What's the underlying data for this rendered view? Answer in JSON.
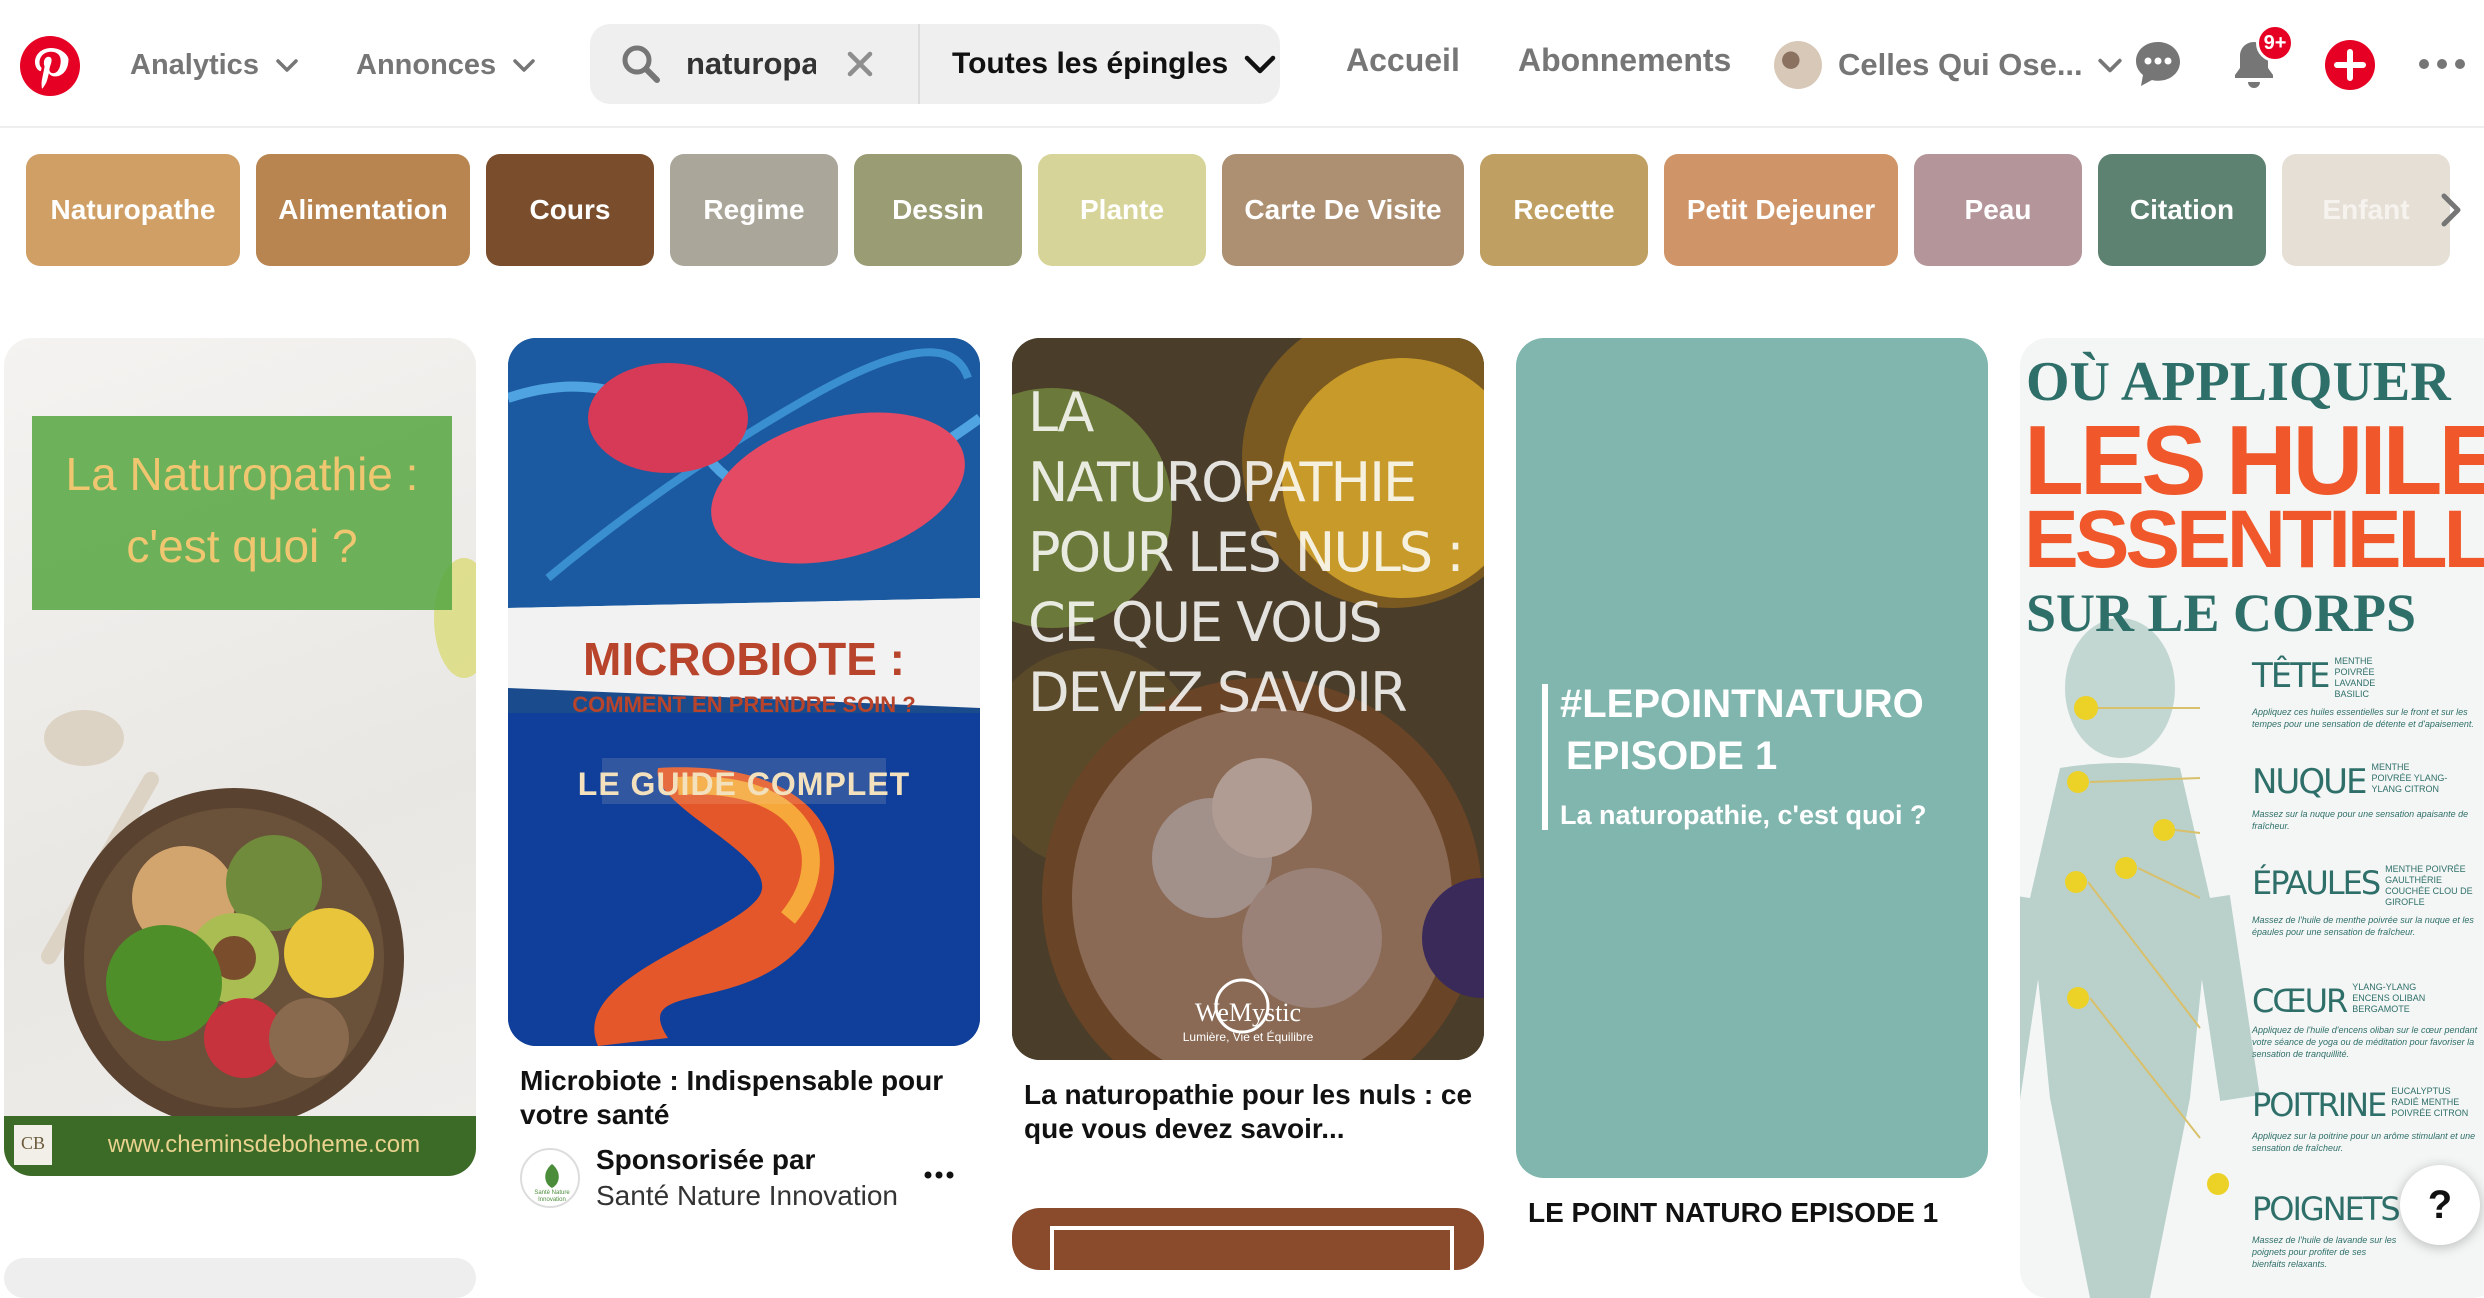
{
  "header": {
    "nav_analytics": "Analytics",
    "nav_annonces": "Annonces",
    "search_value": "naturopa",
    "search_scope": "Toutes les épingles",
    "link_accueil": "Accueil",
    "link_abonnements": "Abonnements",
    "account_name": "Celles Qui Ose...",
    "notif_badge": "9+"
  },
  "chips": [
    {
      "label": "Naturopathe",
      "color": "#cf9f66"
    },
    {
      "label": "Alimentation",
      "color": "#b8844f"
    },
    {
      "label": "Cours",
      "color": "#7a4e2c"
    },
    {
      "label": "Regime",
      "color": "#aaa69a"
    },
    {
      "label": "Dessin",
      "color": "#9a9c74"
    },
    {
      "label": "Plante",
      "color": "#d7d49a"
    },
    {
      "label": "Carte De Visite",
      "color": "#ad9072"
    },
    {
      "label": "Recette",
      "color": "#bf9f62"
    },
    {
      "label": "Petit Dejeuner",
      "color": "#cf9568"
    },
    {
      "label": "Peau",
      "color": "#b4969a"
    },
    {
      "label": "Citation",
      "color": "#5e8272"
    },
    {
      "label": "Enfant",
      "color": "#e6dfd6"
    }
  ],
  "pins": {
    "p1": {
      "heading": "La Naturopathie :\nc'est quoi ?",
      "footer_url": "www.cheminsdeboheme.com",
      "logo_text": "CB"
    },
    "p2": {
      "headline": "MICROBIOTE :",
      "subline": "COMMENT EN PRENDRE SOIN ?",
      "banner": "LE GUIDE COMPLET",
      "title": "Microbiote : Indispensable pour votre santé",
      "sponsored_label": "Sponsorisée par",
      "sponsor": "Santé Nature Innovation",
      "sponsor_logo_text": "Santé Nature Innovation"
    },
    "p3": {
      "overlay": "LA NATUROPATHIE POUR LES NULS : CE QUE VOUS DEVEZ SAVOIR",
      "brand": "WeMystic",
      "brand_tagline": "Lumière, Vie et Équilibre",
      "title": "La naturopathie pour les nuls : ce que vous devez savoir..."
    },
    "p4": {
      "hashtag_line1": "#LEPOINTNATURO",
      "hashtag_line2": "EPISODE 1",
      "sub": "La naturopathie, c'est quoi ?",
      "title": "LE POINT NATURO EPISODE 1"
    },
    "p5": {
      "line1": "OÙ APPLIQUER",
      "line2": "LES HUILES",
      "line3": "ESSENTIELLES",
      "line4": "SUR LE CORPS",
      "parts": [
        {
          "name": "TÊTE",
          "oils": "MENTHE POIVRÉE LAVANDE BASILIC",
          "desc": "Appliquez ces huiles essentielles sur le front et sur les tempes pour une sensation de détente et d'apaisement."
        },
        {
          "name": "NUQUE",
          "oils": "MENTHE POIVRÉE YLANG-YLANG CITRON",
          "desc": "Massez sur la nuque pour une sensation apaisante de fraîcheur."
        },
        {
          "name": "ÉPAULES",
          "oils": "MENTHE POIVRÉE GAULTHÉRIE COUCHÉE CLOU DE GIROFLE",
          "desc": "Massez de l'huile de menthe poivrée sur la nuque et les épaules pour une sensation de fraîcheur."
        },
        {
          "name": "CŒUR",
          "oils": "YLANG-YLANG ENCENS OLIBAN BERGAMOTE",
          "desc": "Appliquez de l'huile d'encens oliban sur le cœur pendant votre séance de yoga ou de méditation pour favoriser la sensation de tranquillité."
        },
        {
          "name": "POITRINE",
          "oils": "EUCALYPTUS RADIÉ MENTHE POIVRÉE CITRON",
          "desc": "Appliquez sur la poitrine pour un arôme stimulant et une sensation de fraîcheur."
        },
        {
          "name": "POIGNETS",
          "oils": "",
          "desc": "Massez de l'huile de lavande sur les poignets pour profiter de ses bienfaits relaxants."
        }
      ]
    }
  },
  "help_label": "?"
}
